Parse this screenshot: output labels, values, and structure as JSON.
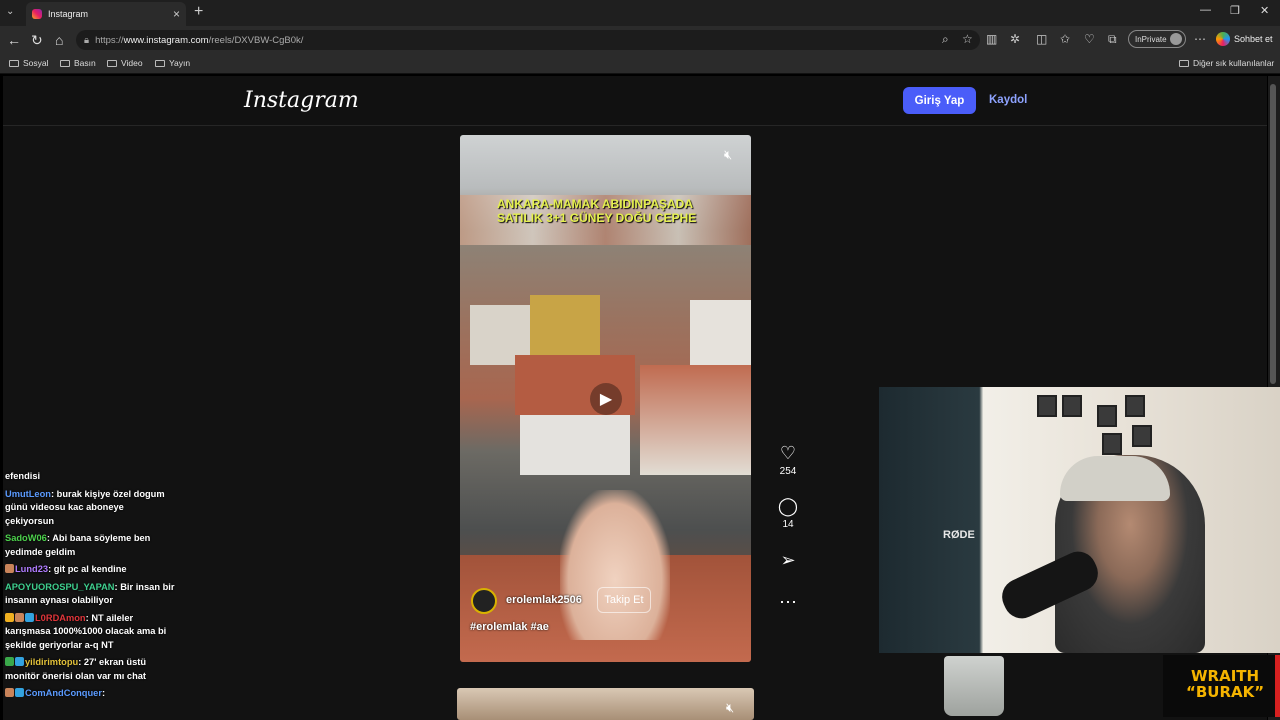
{
  "browser": {
    "tab_title": "Instagram",
    "new_tab": "+",
    "tab_menu": "⌄",
    "url_prefix": "https://",
    "url_host": "www.instagram.com",
    "url_path": "/reels/DXVBW-CgB0k/",
    "inprivate": "InPrivate",
    "copilot": "Sohbet et",
    "bookmarks": [
      "Sosyal",
      "Basın",
      "Video",
      "Yayın"
    ],
    "other_bookmarks": "Diğer sık kullanılanlar"
  },
  "instagram": {
    "logo": "Instagram",
    "login": "Giriş Yap",
    "signup": "Kaydol"
  },
  "reel": {
    "caption": "ANKARA-MAMAK ABIDINPAŞADA SATILIK 3+1 GÜNEY DOĞU CEPHE",
    "author": "erolemlak2506",
    "follow": "Takip Et",
    "tags": "#erolemlak #ae",
    "likes": "254",
    "comments": "14"
  },
  "chat": [
    {
      "user": "",
      "text": "efendisi",
      "color": "#ffffff",
      "badges": []
    },
    {
      "user": "UmutLeon",
      "text": "burak kişiye özel dogum günü videosu kac aboneye çekiyorsun",
      "color": "#5b9bff",
      "badges": []
    },
    {
      "user": "SadoW06",
      "text": "Abi bana söyleme ben yedimde geldim",
      "color": "#4cd14c",
      "badges": []
    },
    {
      "user": "Lund23",
      "text": "git pc al kendine",
      "color": "#b07cff",
      "badges": [
        "#c9845a"
      ]
    },
    {
      "user": "APOYUOROSPU_YAPAN",
      "text": "Bir insan bir insanın aynası olabiliyor",
      "color": "#3ecf8e",
      "badges": []
    },
    {
      "user": "L0RDAmon",
      "text": "NT aileler karışmasa 1000%1000 olacak ama bi şekilde geriyorlar a-q NT",
      "color": "#e0353a",
      "badges": [
        "#f0b020",
        "#c9845a",
        "#33a3e0"
      ]
    },
    {
      "user": "yildirimtopu",
      "text": "27' ekran üstü monitör önerisi olan var mı chat",
      "color": "#e3c23a",
      "badges": [
        "#3aa84a",
        "#33a3e0"
      ]
    },
    {
      "user": "ComAndConquer",
      "text": "",
      "color": "#5b9bff",
      "badges": [
        "#c9845a",
        "#33a3e0"
      ]
    }
  ],
  "overlay": {
    "mic_brand": "RØDE",
    "brand_line1": "WRAITH",
    "brand_line2": "“BURAK”"
  }
}
